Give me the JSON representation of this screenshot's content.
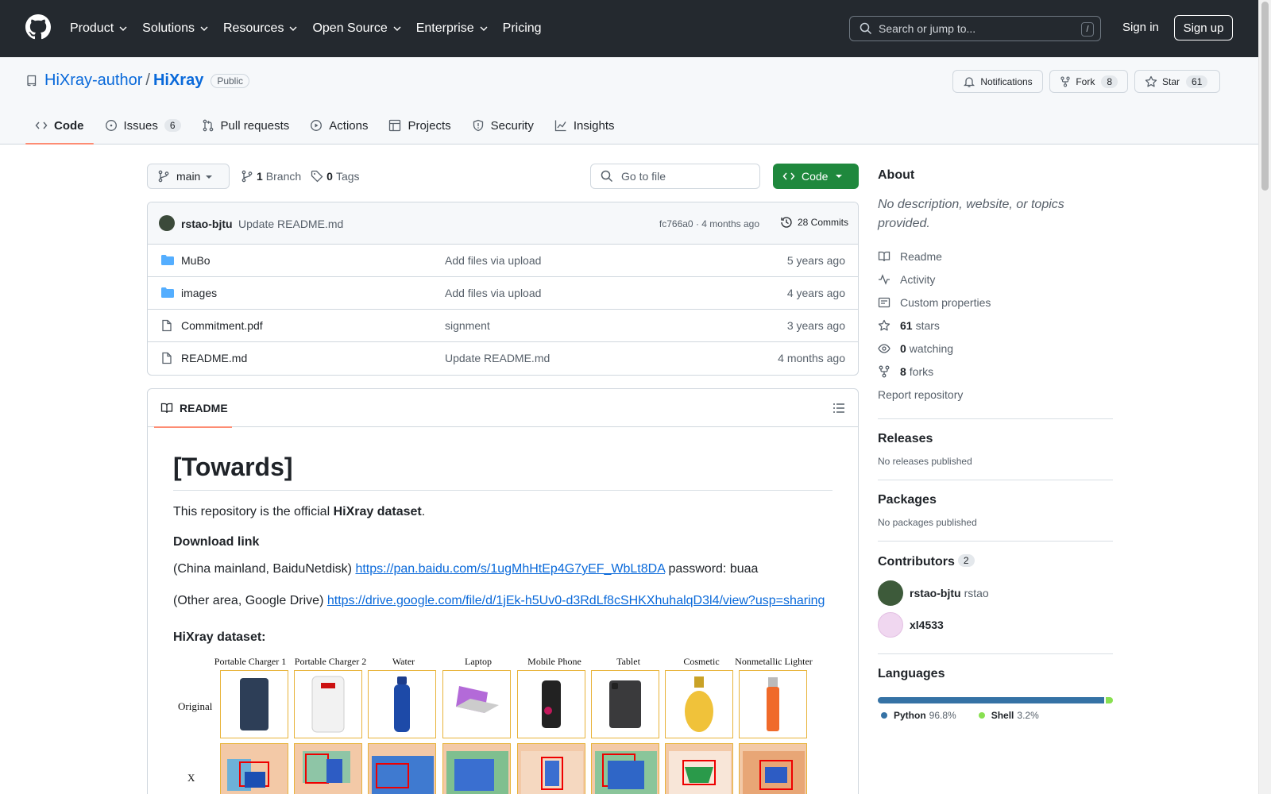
{
  "header": {
    "nav": [
      "Product",
      "Solutions",
      "Resources",
      "Open Source",
      "Enterprise",
      "Pricing"
    ],
    "search_placeholder": "Search or jump to...",
    "search_shortcut": "/",
    "sign_in": "Sign in",
    "sign_up": "Sign up"
  },
  "repo": {
    "owner": "HiXray-author",
    "separator": "/",
    "name": "HiXray",
    "visibility": "Public",
    "notifications_label": "Notifications",
    "fork_label": "Fork",
    "fork_count": "8",
    "star_label": "Star",
    "star_count": "61"
  },
  "tabs": [
    {
      "label": "Code",
      "icon": "code-icon"
    },
    {
      "label": "Issues",
      "icon": "issue-icon",
      "count": "6"
    },
    {
      "label": "Pull requests",
      "icon": "pull-request-icon"
    },
    {
      "label": "Actions",
      "icon": "play-icon"
    },
    {
      "label": "Projects",
      "icon": "table-icon"
    },
    {
      "label": "Security",
      "icon": "shield-icon"
    },
    {
      "label": "Insights",
      "icon": "graph-icon"
    }
  ],
  "branch": {
    "current": "main",
    "branch_count": "1",
    "branch_label": "Branch",
    "tag_count": "0",
    "tag_label": "Tags",
    "goto_file_placeholder": "Go to file",
    "code_button": "Code"
  },
  "commit": {
    "author": "rstao-bjtu",
    "message": "Update README.md",
    "meta": "fc766a0 · 4 months ago",
    "commits_label": "28 Commits"
  },
  "files": [
    {
      "type": "folder",
      "name": "MuBo",
      "message": "Add files via upload",
      "age": "5 years ago"
    },
    {
      "type": "folder",
      "name": "images",
      "message": "Add files via upload",
      "age": "4 years ago"
    },
    {
      "type": "file",
      "name": "Commitment.pdf",
      "message": "signment",
      "age": "3 years ago"
    },
    {
      "type": "file",
      "name": "README.md",
      "message": "Update README.md",
      "age": "4 months ago"
    }
  ],
  "readme": {
    "tab_label": "README",
    "h1": "[Towards]",
    "intro_prefix": "This repository is the official ",
    "intro_bold": "HiXray dataset",
    "intro_suffix": ".",
    "download_heading": "Download link",
    "baidu_prefix": "(China mainland, BaiduNetdisk) ",
    "baidu_link": "https://pan.baidu.com/s/1ugMhHtEp4G7yEF_WbLt8DA",
    "baidu_suffix": " password: buaa",
    "google_prefix": "(Other area, Google Drive) ",
    "google_link": "https://drive.google.com/file/d/1jEk-h5Uv0-d3RdLf8cSHKXhuhalqD3l4/view?usp=sharing",
    "dataset_heading": "HiXray dataset:",
    "figure": {
      "columns": [
        "Portable Charger 1",
        "Portable Charger 2",
        "Water",
        "Laptop",
        "Mobile Phone",
        "Tablet",
        "Cosmetic",
        "Nonmetallic Lighter"
      ],
      "row_original": "Original",
      "row_xray": "X"
    }
  },
  "sidebar": {
    "about_title": "About",
    "about_desc": "No description, website, or topics provided.",
    "links": [
      {
        "icon": "book-icon",
        "label": "Readme"
      },
      {
        "icon": "pulse-icon",
        "label": "Activity"
      },
      {
        "icon": "note-icon",
        "label": "Custom properties"
      },
      {
        "icon": "star-icon",
        "count": "61",
        "label": "stars"
      },
      {
        "icon": "eye-icon",
        "count": "0",
        "label": "watching"
      },
      {
        "icon": "fork-icon",
        "count": "8",
        "label": "forks"
      }
    ],
    "report": "Report repository",
    "releases_title": "Releases",
    "releases_empty": "No releases published",
    "packages_title": "Packages",
    "packages_empty": "No packages published",
    "contributors_title": "Contributors",
    "contributors_count": "2",
    "contributors": [
      {
        "name": "rstao-bjtu",
        "login": "rstao"
      },
      {
        "name": "xl4533",
        "login": ""
      }
    ],
    "languages_title": "Languages",
    "languages": [
      {
        "name": "Python",
        "percent": "96.8%",
        "share": 96.8,
        "color": "#3572A5"
      },
      {
        "name": "Shell",
        "percent": "3.2%",
        "share": 3.2,
        "color": "#89e051"
      }
    ]
  }
}
